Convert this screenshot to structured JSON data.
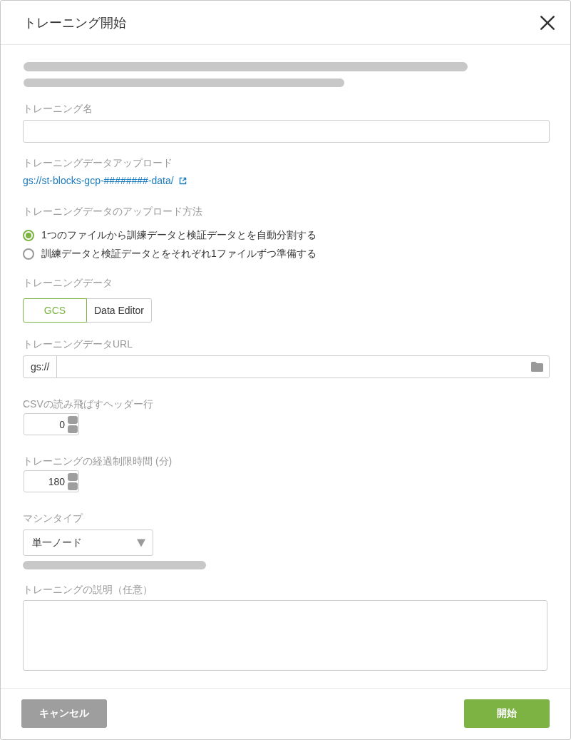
{
  "dialog": {
    "title": "トレーニング開始"
  },
  "intro_text": {
    "redacted": true
  },
  "fields": [
    {
      "kind": "text",
      "label": "トレーニング名"
    },
    {
      "kind": "link",
      "label": "トレーニングデータアップロード",
      "link": "gs://st-blocks-gcp-########-data/"
    },
    {
      "kind": "radio",
      "label": "トレーニングデータのアップロード方法",
      "options": [
        {
          "label": "1つのファイルから訓練データと検証データとを自動分割する",
          "selected": true
        },
        {
          "label": "訓練データと検証データとをそれぞれ1ファイルずつ準備する",
          "selected": false
        }
      ]
    },
    {
      "kind": "segmented",
      "label": "トレーニングデータ",
      "options": [
        {
          "label": "GCS",
          "selected": true
        },
        {
          "label": "Data Editor",
          "selected": false
        }
      ]
    },
    {
      "kind": "url",
      "label": "トレーニングデータURL",
      "prefix": "gs://"
    },
    {
      "kind": "number",
      "label": "CSVの読み飛ばすヘッダー行",
      "value": "0"
    },
    {
      "kind": "number",
      "label": "トレーニングの経過制限時間 (分)",
      "value": "180"
    },
    {
      "kind": "select",
      "label": "マシンタイプ",
      "value": "単一ノード",
      "help": {
        "redacted": true
      }
    },
    {
      "kind": "textarea",
      "label": "トレーニングの説明（任意）"
    }
  ],
  "buttons": [
    {
      "label": "キャンセル",
      "kind": "secondary"
    },
    {
      "label": "開始",
      "kind": "primary"
    }
  ]
}
